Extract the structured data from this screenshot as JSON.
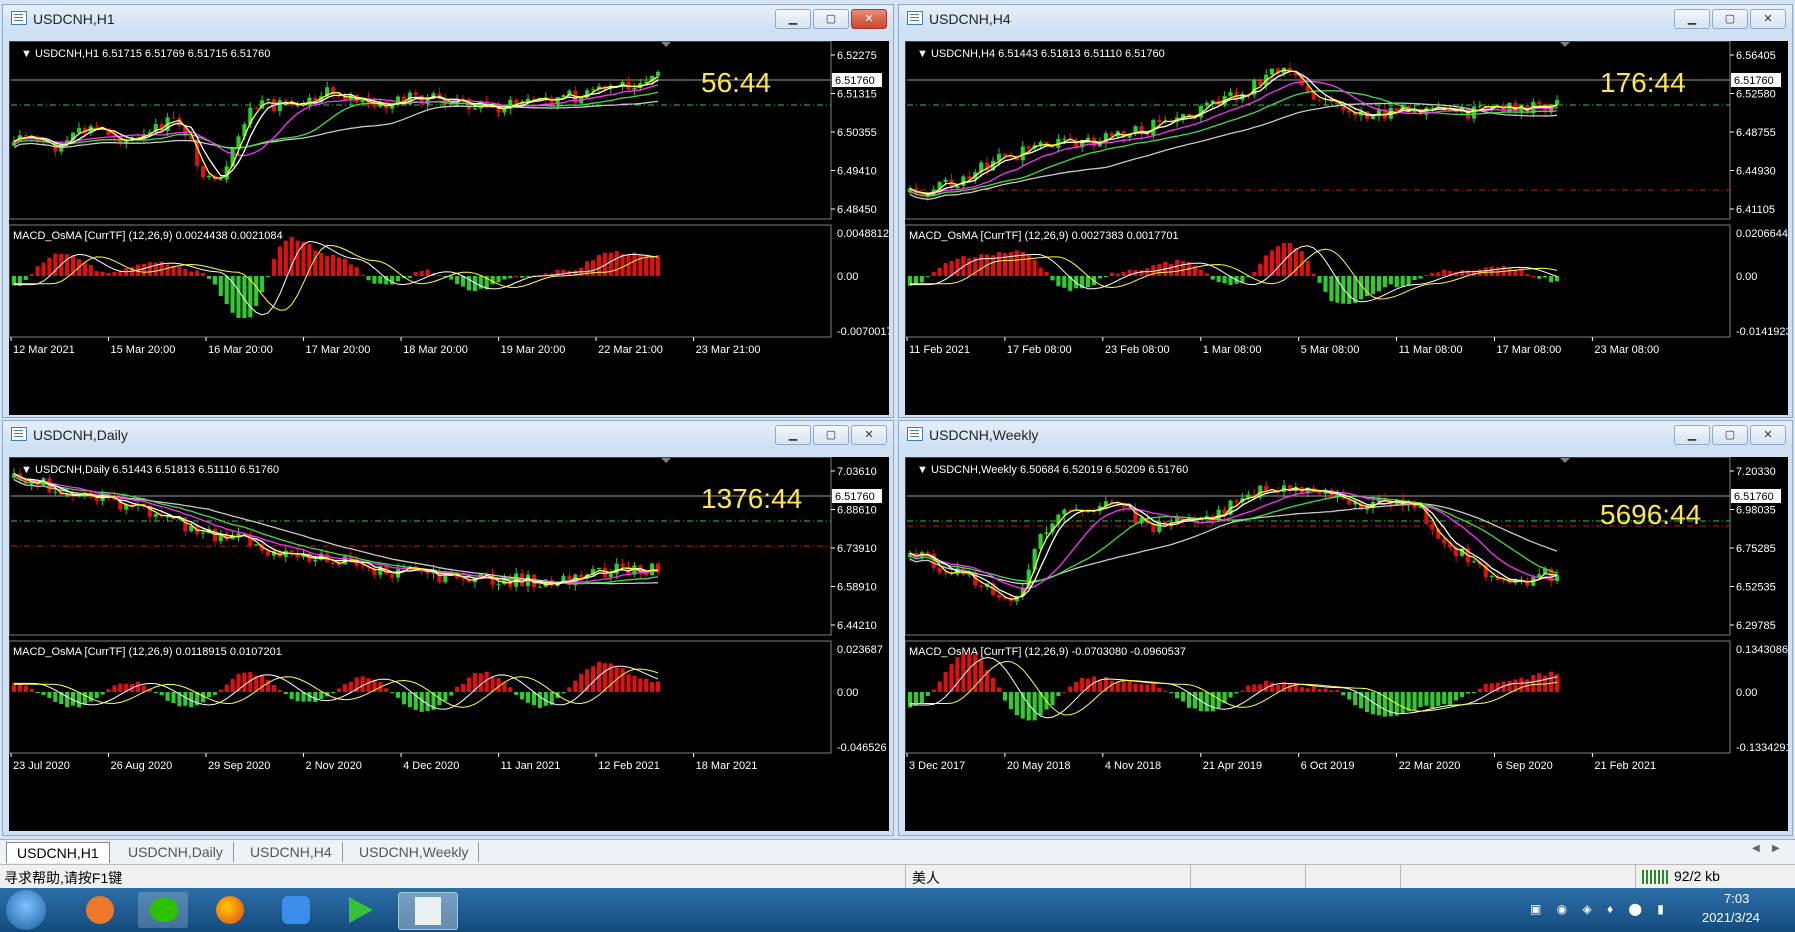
{
  "windows": [
    {
      "id": "h1",
      "title": "USDCNH,H1",
      "header": "USDCNH,H1  6.51715 6.51769 6.51715 6.51760",
      "price_labels": [
        "6.52275",
        "6.51315",
        "6.50355",
        "6.49410",
        "6.48450"
      ],
      "current_price": "6.51760",
      "countdown": "56:44",
      "macd_header": "MACD_OsMA [CurrTF] (12,26,9) 0.0024438 0.0021084",
      "macd_labels": [
        "0.0048812",
        "0.00",
        "-0.0070017"
      ],
      "dates": [
        "12 Mar 2021",
        "15 Mar 20:00",
        "16 Mar 20:00",
        "17 Mar 20:00",
        "18 Mar 20:00",
        "19 Mar 20:00",
        "22 Mar 21:00",
        "23 Mar 21:00"
      ]
    },
    {
      "id": "h4",
      "title": "USDCNH,H4",
      "header": "USDCNH,H4  6.51443 6.51813 6.51110 6.51760",
      "price_labels": [
        "6.56405",
        "6.52580",
        "6.48755",
        "6.44930",
        "6.41105"
      ],
      "current_price": "6.51760",
      "countdown": "176:44",
      "macd_header": "MACD_OsMA [CurrTF] (12,26,9) 0.0027383 0.0017701",
      "macd_labels": [
        "0.0206644",
        "0.00",
        "-0.0141923"
      ],
      "dates": [
        "11 Feb 2021",
        "17 Feb 08:00",
        "23 Feb 08:00",
        "1 Mar 08:00",
        "5 Mar 08:00",
        "11 Mar 08:00",
        "17 Mar 08:00",
        "23 Mar 08:00"
      ]
    },
    {
      "id": "daily",
      "title": "USDCNH,Daily",
      "header": "USDCNH,Daily  6.51443 6.51813 6.51110 6.51760",
      "price_labels": [
        "7.03610",
        "6.88610",
        "6.73910",
        "6.58910",
        "6.44210"
      ],
      "current_price": "6.51760",
      "countdown": "1376:44",
      "macd_header": "MACD_OsMA [CurrTF] (12,26,9) 0.0118915 0.0107201",
      "macd_labels": [
        "0.023687",
        "0.00",
        "-0.046526"
      ],
      "dates": [
        "23 Jul 2020",
        "26 Aug 2020",
        "29 Sep 2020",
        "2 Nov 2020",
        "4 Dec 2020",
        "11 Jan 2021",
        "12 Feb 2021",
        "18 Mar 2021"
      ]
    },
    {
      "id": "weekly",
      "title": "USDCNH,Weekly",
      "header": "USDCNH,Weekly  6.50684 6.52019 6.50209 6.51760",
      "price_labels": [
        "7.20330",
        "6.98035",
        "6.75285",
        "6.52535",
        "6.29785"
      ],
      "current_price": "6.51760",
      "countdown": "5696:44",
      "macd_header": "MACD_OsMA [CurrTF] (12,26,9) -0.0703080 -0.0960537",
      "macd_labels": [
        "0.1343086",
        "0.00",
        "-0.1334291"
      ],
      "dates": [
        "3 Dec 2017",
        "20 May 2018",
        "4 Nov 2018",
        "21 Apr 2019",
        "6 Oct 2019",
        "22 Mar 2020",
        "6 Sep 2020",
        "21 Feb 2021"
      ]
    }
  ],
  "tabs": [
    "USDCNH,H1",
    "USDCNH,Daily",
    "USDCNH,H4",
    "USDCNH,Weekly"
  ],
  "status": {
    "help": "寻求帮助,请按F1键",
    "profile": "美人",
    "traffic": "92/2 kb"
  },
  "taskbar": {
    "time": "7:03",
    "date": "2021/3/24"
  },
  "colors": {
    "bull": "#2ecc2e",
    "bear": "#e01010",
    "ma_yellow": "#ffff40",
    "ma_white": "#ffffff",
    "ma_magenta": "#ff30ff",
    "ma_green": "#40e040",
    "ma_gray": "#c8c8c8",
    "countdown": "#ffe650"
  }
}
